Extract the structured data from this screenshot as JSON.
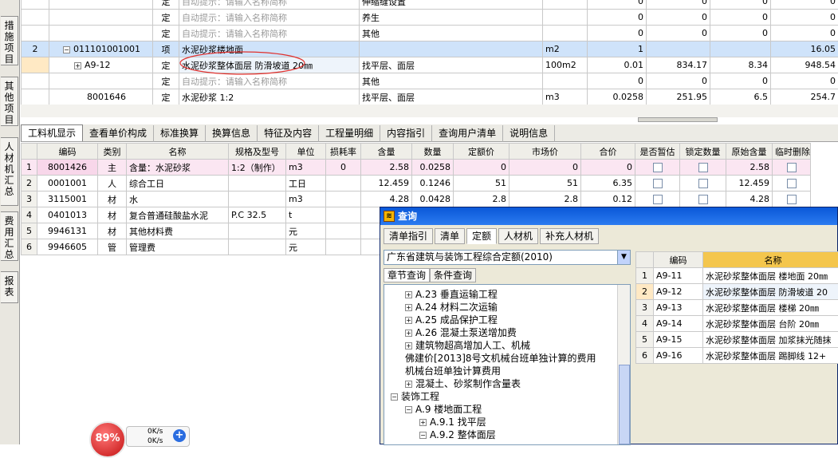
{
  "side_tabs": [
    "措施项目",
    "其他项目",
    "人材机汇总",
    "费用汇总",
    "报表"
  ],
  "top_rows": [
    {
      "seq": "",
      "code": "",
      "type": "定",
      "name": "自动提示：请输入名称简称",
      "name_hint": true,
      "feature": "伸缩缝设置",
      "unit": "",
      "qty": "0",
      "price": "0",
      "total": "0",
      "sum": "0"
    },
    {
      "seq": "",
      "code": "",
      "type": "定",
      "name": "自动提示：请输入名称简称",
      "name_hint": true,
      "feature": "养生",
      "unit": "",
      "qty": "0",
      "price": "0",
      "total": "0",
      "sum": "0"
    },
    {
      "seq": "",
      "code": "",
      "type": "定",
      "name": "自动提示：请输入名称简称",
      "name_hint": true,
      "feature": "其他",
      "unit": "",
      "qty": "0",
      "price": "0",
      "total": "0",
      "sum": "0"
    },
    {
      "seq": "2",
      "code": "011101001001",
      "type": "项",
      "name": "水泥砂浆楼地面",
      "name_hint": false,
      "feature": "",
      "unit": "m2",
      "qty": "1",
      "price": "",
      "total": "",
      "sum": "16.05"
    },
    {
      "seq": "",
      "code": "A9-12",
      "type": "定",
      "name": "水泥砂浆整体面层 防滑坡道 20㎜",
      "name_hint": false,
      "feature": "找平层、面层",
      "unit": "100m2",
      "qty": "0.01",
      "price": "834.17",
      "total": "8.34",
      "sum": "948.54"
    },
    {
      "seq": "",
      "code": "",
      "type": "定",
      "name": "自动提示：请输入名称简称",
      "name_hint": true,
      "feature": "其他",
      "unit": "",
      "qty": "0",
      "price": "0",
      "total": "0",
      "sum": "0"
    },
    {
      "seq": "",
      "code": "8001646",
      "type": "定",
      "name": "水泥砂浆 1:2",
      "name_hint": false,
      "feature": "找平层、面层",
      "unit": "m3",
      "qty": "0.0258",
      "price": "251.95",
      "total": "6.5",
      "sum": "254.7"
    }
  ],
  "bottom_tabs": [
    "工料机显示",
    "查看单价构成",
    "标准换算",
    "换算信息",
    "特征及内容",
    "工程量明细",
    "内容指引",
    "查询用户清单",
    "说明信息"
  ],
  "res_headers": [
    "",
    "编码",
    "类别",
    "名称",
    "规格及型号",
    "单位",
    "损耗率",
    "含量",
    "数量",
    "定额价",
    "市场价",
    "合价",
    "是否暂估",
    "锁定数量",
    "原始含量",
    "临时删除"
  ],
  "res_rows": [
    {
      "n": "1",
      "code": "8001426",
      "cat": "主",
      "name": "含量：水泥砂浆",
      "spec": "1:2（制作）",
      "unit": "m3",
      "loss": "0",
      "qty": "2.58",
      "amount": "0.0258",
      "quota": "0",
      "market": "0",
      "total": "0",
      "orig": "2.58"
    },
    {
      "n": "2",
      "code": "0001001",
      "cat": "人",
      "name": "综合工日",
      "spec": "",
      "unit": "工日",
      "loss": "",
      "qty": "12.459",
      "amount": "0.1246",
      "quota": "51",
      "market": "51",
      "total": "6.35",
      "orig": "12.459"
    },
    {
      "n": "3",
      "code": "3115001",
      "cat": "材",
      "name": "水",
      "spec": "",
      "unit": "m3",
      "loss": "",
      "qty": "4.28",
      "amount": "0.0428",
      "quota": "2.8",
      "market": "2.8",
      "total": "0.12",
      "orig": "4.28"
    },
    {
      "n": "4",
      "code": "0401013",
      "cat": "材",
      "name": "复合普通硅酸盐水泥",
      "spec": "P.C 32.5",
      "unit": "t",
      "loss": "",
      "qty": "0",
      "amount": "",
      "quota": "",
      "market": "",
      "total": "",
      "orig": ""
    },
    {
      "n": "5",
      "code": "9946131",
      "cat": "材",
      "name": "其他材料费",
      "spec": "",
      "unit": "元",
      "loss": "",
      "qty": "2",
      "amount": "",
      "quota": "",
      "market": "",
      "total": "",
      "orig": ""
    },
    {
      "n": "6",
      "code": "9946605",
      "cat": "管",
      "name": "管理费",
      "spec": "",
      "unit": "元",
      "loss": "",
      "qty": "11",
      "amount": "",
      "quota": "",
      "market": "",
      "total": "",
      "orig": ""
    }
  ],
  "query": {
    "title": "查询",
    "tabs": [
      "清单指引",
      "清单",
      "定额",
      "人材机",
      "补充人材机"
    ],
    "combo": "广东省建筑与装饰工程综合定额(2010)",
    "subtabs": [
      "章节查询",
      "条件查询"
    ],
    "tree": [
      {
        "label": "A.23 垂直运输工程",
        "pm": "+",
        "indent": 1
      },
      {
        "label": "A.24 材料二次运输",
        "pm": "+",
        "indent": 1
      },
      {
        "label": "A.25 成品保护工程",
        "pm": "+",
        "indent": 1
      },
      {
        "label": "A.26 混凝土泵送增加费",
        "pm": "+",
        "indent": 1
      },
      {
        "label": "建筑物超高增加人工、机械",
        "pm": "+",
        "indent": 1
      },
      {
        "label": "佛建价[2013]8号文机械台班单独计算的费用",
        "pm": "",
        "indent": 1
      },
      {
        "label": "机械台班单独计算费用",
        "pm": "",
        "indent": 1
      },
      {
        "label": "混凝土、砂浆制作含量表",
        "pm": "+",
        "indent": 1
      },
      {
        "label": "装饰工程",
        "pm": "-",
        "indent": 0
      },
      {
        "label": "A.9 楼地面工程",
        "pm": "-",
        "indent": 1
      },
      {
        "label": "A.9.1 找平层",
        "pm": "+",
        "indent": 2
      },
      {
        "label": "A.9.2 整体面层",
        "pm": "-",
        "indent": 2
      }
    ],
    "list_headers": [
      "",
      "编码",
      "名称"
    ],
    "list_rows": [
      {
        "n": "1",
        "code": "A9-11",
        "name": "水泥砂浆整体面层 楼地面 20㎜"
      },
      {
        "n": "2",
        "code": "A9-12",
        "name": "水泥砂浆整体面层 防滑坡道 20"
      },
      {
        "n": "3",
        "code": "A9-13",
        "name": "水泥砂浆整体面层 楼梯 20㎜"
      },
      {
        "n": "4",
        "code": "A9-14",
        "name": "水泥砂浆整体面层 台阶 20㎜"
      },
      {
        "n": "5",
        "code": "A9-15",
        "name": "水泥砂浆整体面层 加浆抹光随抹"
      },
      {
        "n": "6",
        "code": "A9-16",
        "name": "水泥砂浆整体面层 踢脚线 12+"
      }
    ]
  },
  "widget": {
    "percent": "89%",
    "up": "0K/s",
    "down": "0K/s"
  },
  "colors": {
    "selected_row": "#cfe3fa",
    "title_bar": "#0a58d8",
    "badge": "#c31212"
  }
}
